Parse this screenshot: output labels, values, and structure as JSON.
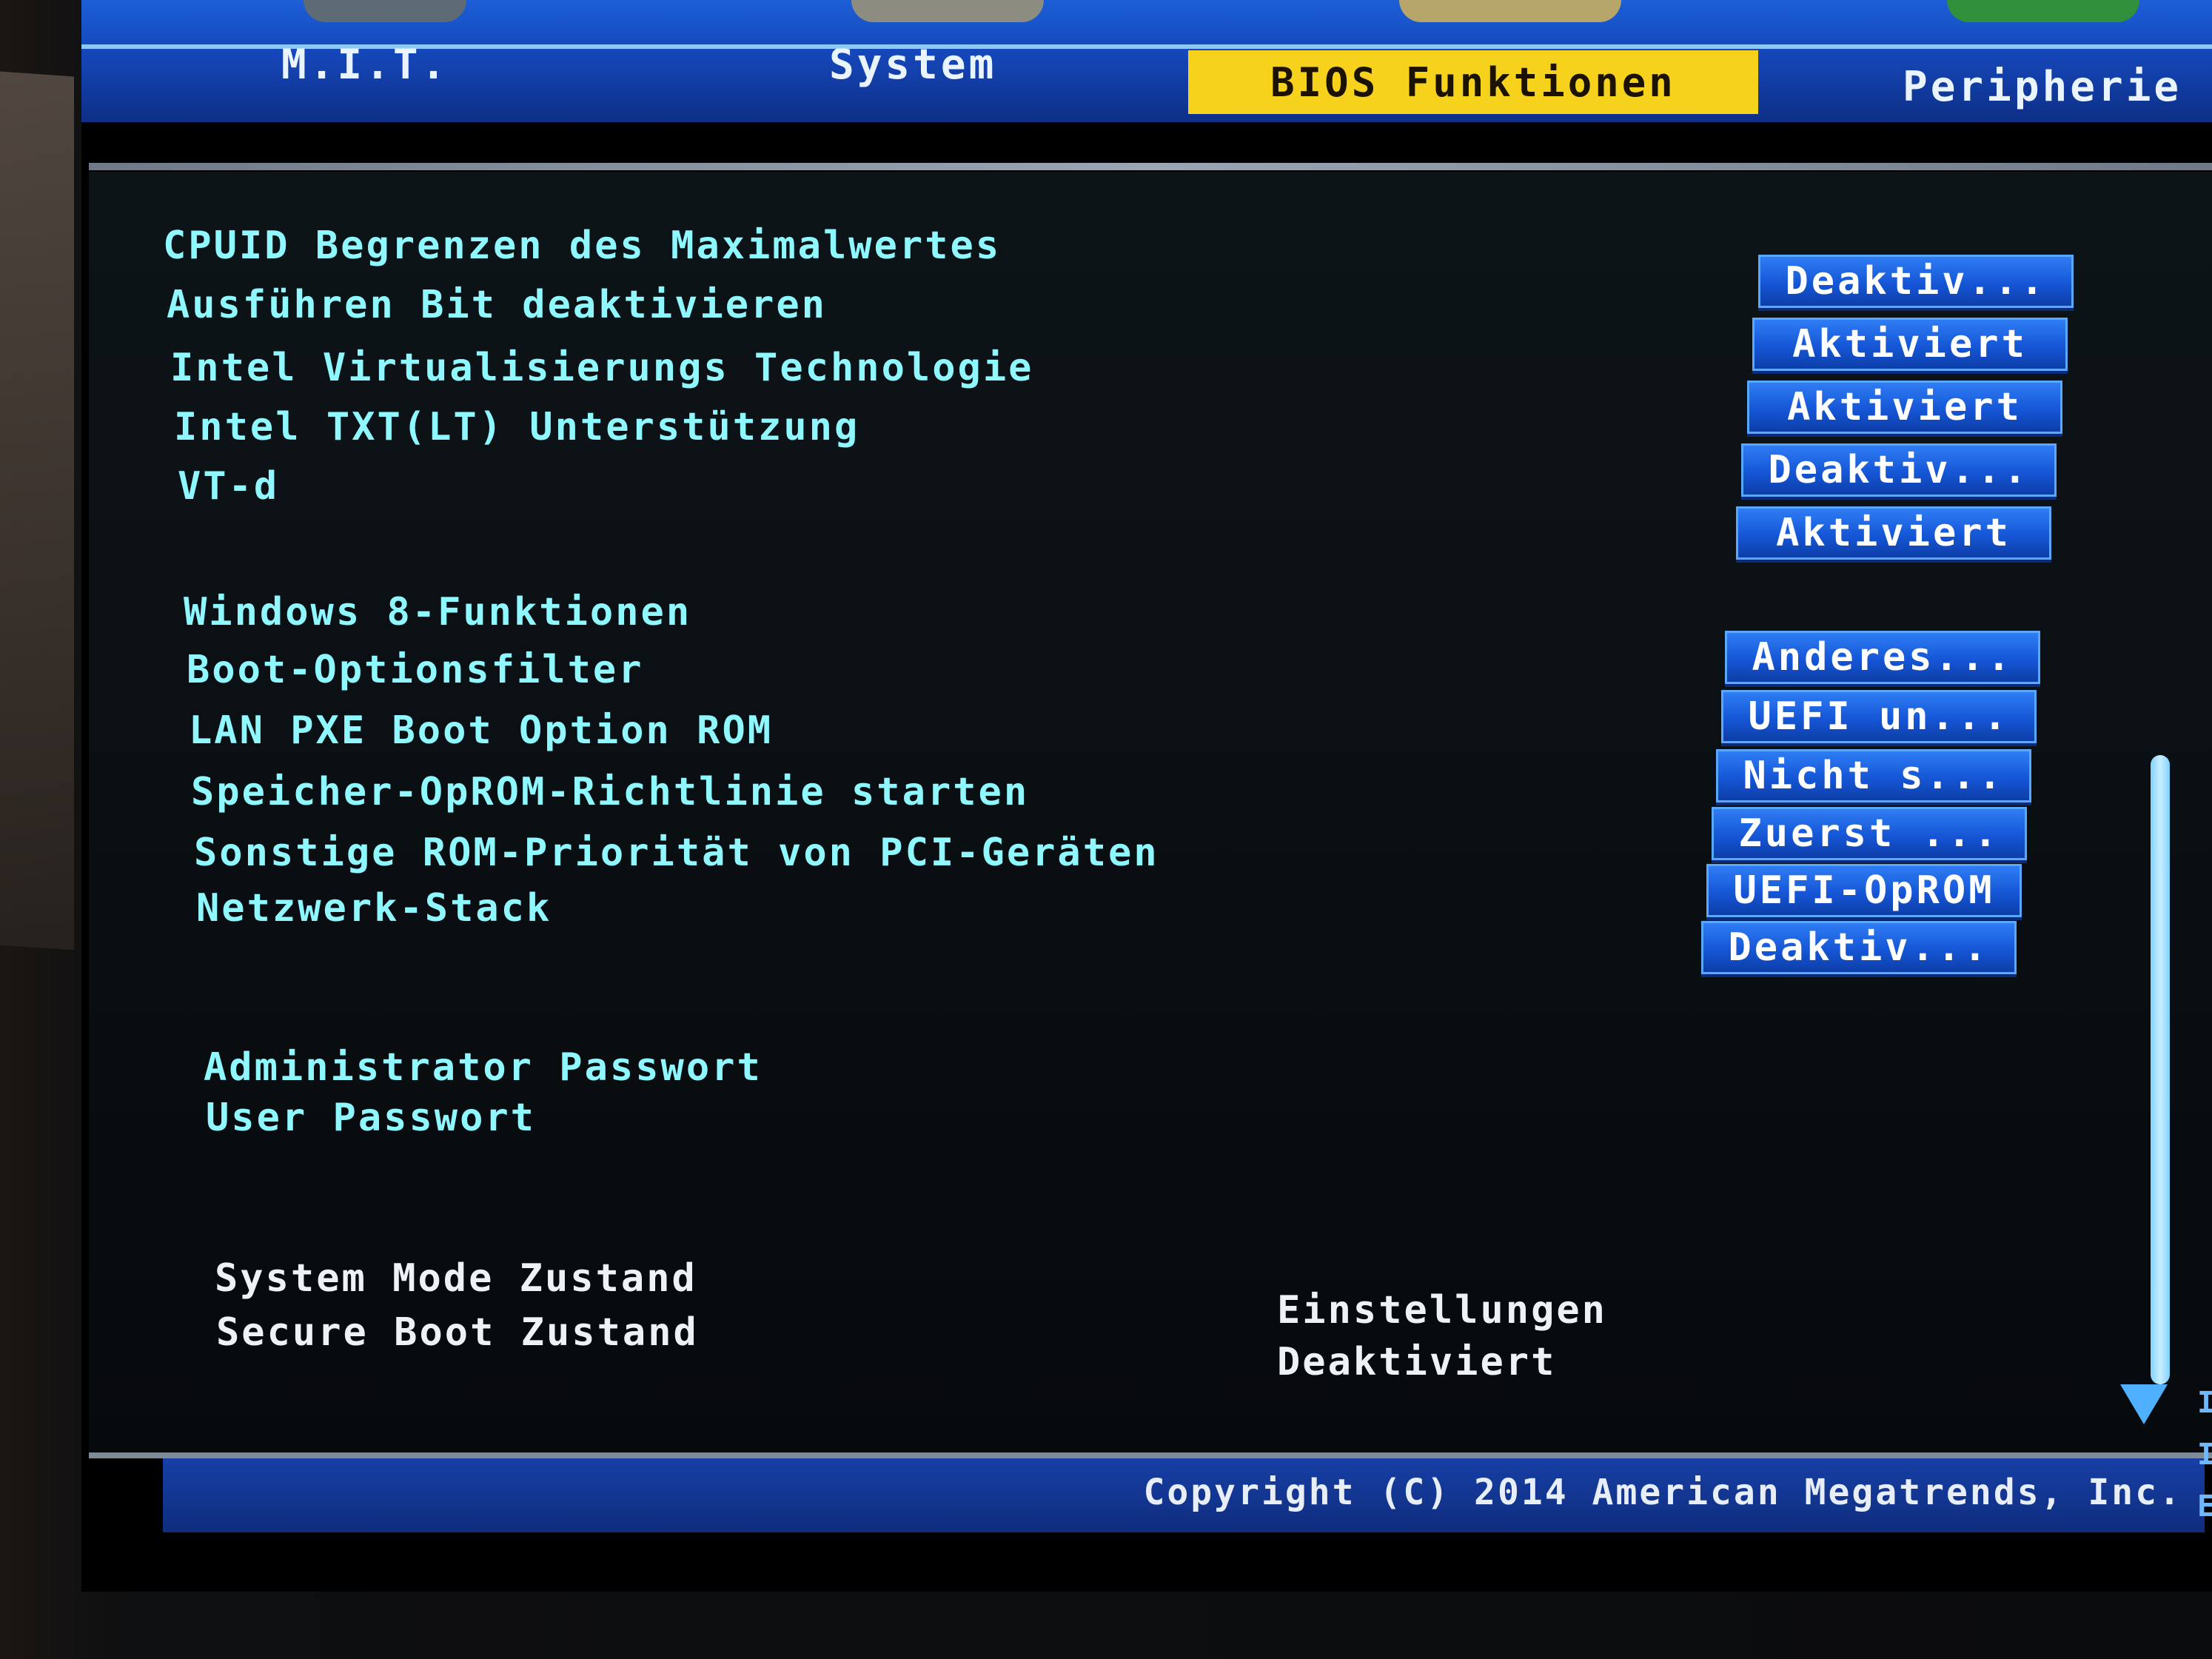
{
  "nav": {
    "tabs": [
      {
        "label": "M.I.T."
      },
      {
        "label": "System"
      },
      {
        "label": "BIOS Funktionen",
        "active": true
      },
      {
        "label": "Peripherie"
      }
    ]
  },
  "group1": [
    {
      "label": "CPUID Begrenzen des Maximalwertes",
      "value": "Deaktiv..."
    },
    {
      "label": "Ausführen Bit deaktivieren",
      "value": "Aktiviert"
    },
    {
      "label": "Intel Virtualisierungs Technologie",
      "value": "Aktiviert"
    },
    {
      "label": "Intel TXT(LT) Unterstützung",
      "value": "Deaktiv..."
    },
    {
      "label": "VT-d",
      "value": "Aktiviert"
    }
  ],
  "group2": [
    {
      "label": "Windows 8-Funktionen",
      "value": "Anderes..."
    },
    {
      "label": "Boot-Optionsfilter",
      "value": "UEFI un..."
    },
    {
      "label": "LAN PXE Boot Option ROM",
      "value": "Nicht s..."
    },
    {
      "label": "Speicher-OpROM-Richtlinie starten",
      "value": "Zuerst ..."
    },
    {
      "label": "Sonstige ROM-Priorität von PCI-Geräten",
      "value": "UEFI-OpROM"
    },
    {
      "label": "Netzwerk-Stack",
      "value": "Deaktiv..."
    }
  ],
  "group3": [
    {
      "label": "Administrator Passwort"
    },
    {
      "label": "User Passwort"
    }
  ],
  "status": {
    "rows": [
      {
        "label": "System Mode Zustand",
        "value": "Einstellungen"
      },
      {
        "label": "Secure Boot Zustand",
        "value": "Deaktiviert"
      }
    ]
  },
  "footer": {
    "copyright": "Copyright (C) 2014 American Megatrends, Inc."
  },
  "edge_glyphs": [
    "I",
    "I",
    "E"
  ],
  "colors": {
    "nav_bar": "#1546b8",
    "active_tab": "#f6d21c",
    "label_cyan": "#8ff8ff",
    "value_button": "#1556d6",
    "footer_bar": "#163fa5"
  }
}
